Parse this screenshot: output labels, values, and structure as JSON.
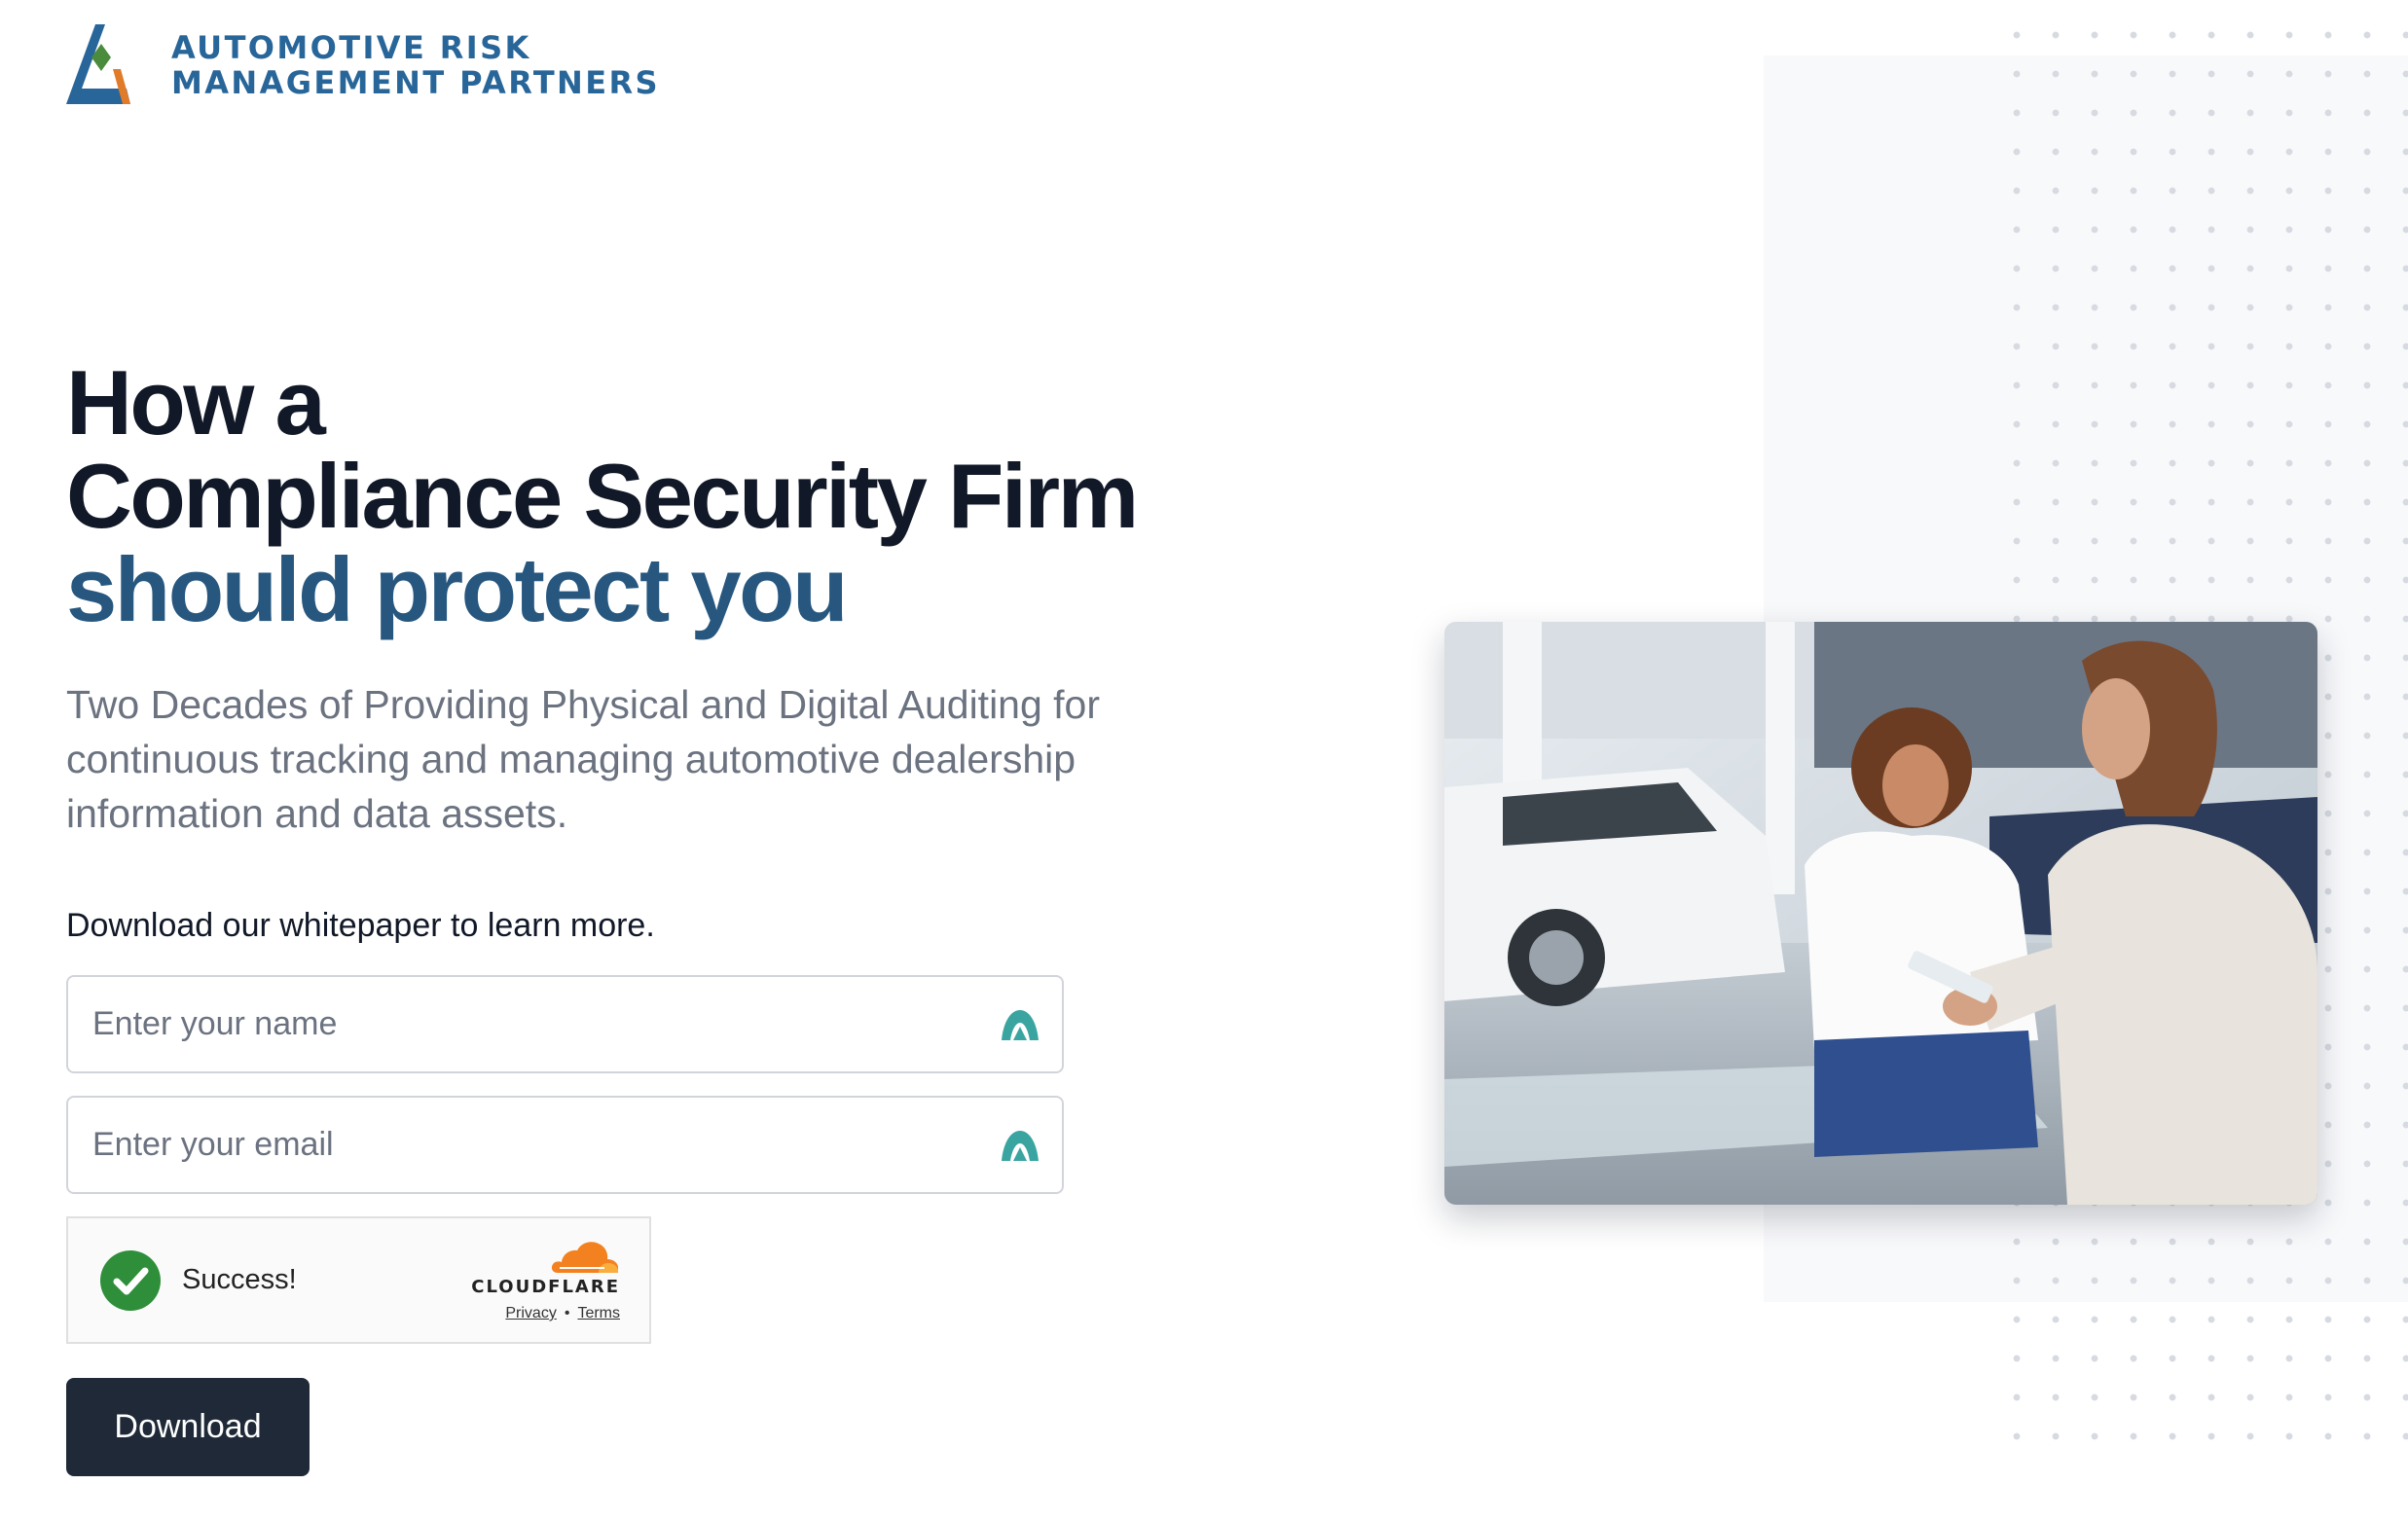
{
  "brand": {
    "line1": "AUTOMOTIVE RISK",
    "line2": "MANAGEMENT PARTNERS",
    "colors": {
      "primary": "#28669a",
      "orange": "#e07b2a",
      "green": "#4a8b3c"
    }
  },
  "hero": {
    "headline_line1": "How a",
    "headline_line2": "Compliance Security Firm",
    "headline_line3": "should protect you",
    "subtitle": "Two Decades of Providing Physical and Digital Auditing for continuous tracking and managing automotive dealership information and data assets.",
    "accent_color": "#27577f"
  },
  "form": {
    "cta": "Download our whitepaper to learn more.",
    "name_field": {
      "placeholder": "Enter your name",
      "value": "",
      "icon": "autofill-icon"
    },
    "email_field": {
      "placeholder": "Enter your email",
      "value": "",
      "icon": "autofill-icon"
    },
    "captcha": {
      "status": "Success!",
      "provider": "CLOUDFLARE",
      "privacy_link": "Privacy",
      "separator": "•",
      "terms_link": "Terms"
    },
    "submit_label": "Download"
  },
  "image": {
    "alt": "Two women talking in a car dealership showroom"
  }
}
